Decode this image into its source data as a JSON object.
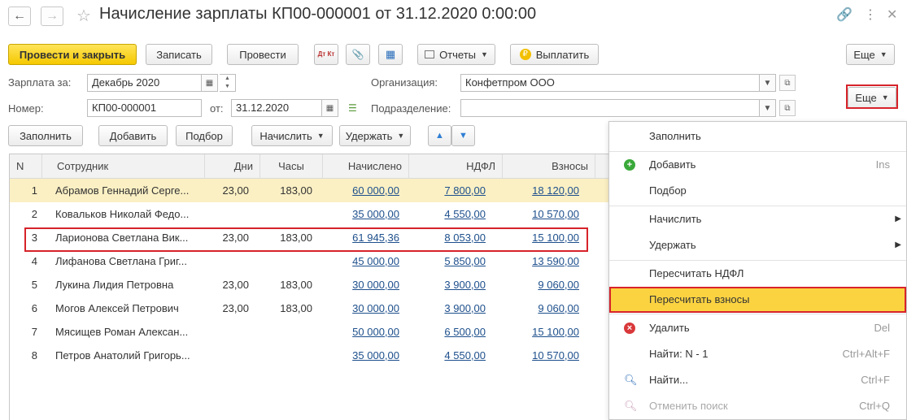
{
  "window": {
    "title": "Начисление зарплаты КП00-000001 от 31.12.2020 0:00:00",
    "back_icon": "←",
    "forward_icon": "→",
    "star_icon": "☆",
    "link_icon": "🔗",
    "more_icon": "⋮",
    "close_icon": "✕"
  },
  "toolbar": {
    "post_close": "Провести и закрыть",
    "save": "Записать",
    "post": "Провести",
    "dt_kt": "Дт Кт",
    "attach_icon": "📎",
    "structure_icon": "▦",
    "reports": "Отчеты",
    "pay": "Выплатить",
    "pay_icon": "₽",
    "more": "Еще"
  },
  "form": {
    "period_label": "Зарплата за:",
    "period_value": "Декабрь 2020",
    "org_label": "Организация:",
    "org_value": "Конфетпром ООО",
    "number_label": "Номер:",
    "number_value": "КП00-000001",
    "date_label": "от:",
    "date_value": "31.12.2020",
    "dept_label": "Подразделение:",
    "dept_value": ""
  },
  "table_toolbar": {
    "fill": "Заполнить",
    "add": "Добавить",
    "select": "Подбор",
    "accrue": "Начислить",
    "withhold": "Удержать",
    "more": "Еще",
    "up_icon": "▲",
    "down_icon": "▼"
  },
  "table": {
    "headers": [
      "N",
      "Сотрудник",
      "Дни",
      "Часы",
      "Начислено",
      "НДФЛ",
      "Взносы"
    ],
    "rows": [
      {
        "n": "1",
        "name": "Абрамов Геннадий Серге...",
        "days": "23,00",
        "hours": "183,00",
        "accrued": "60 000,00",
        "ndfl": "7 800,00",
        "contrib": "18 120,00"
      },
      {
        "n": "2",
        "name": "Ковальков Николай Федо...",
        "days": "",
        "hours": "",
        "accrued": "35 000,00",
        "ndfl": "4 550,00",
        "contrib": "10 570,00"
      },
      {
        "n": "3",
        "name": "Ларионова Светлана Вик...",
        "days": "23,00",
        "hours": "183,00",
        "accrued": "61 945,36",
        "ndfl": "8 053,00",
        "contrib": "15 100,00"
      },
      {
        "n": "4",
        "name": "Лифанова Светлана Григ...",
        "days": "",
        "hours": "",
        "accrued": "45 000,00",
        "ndfl": "5 850,00",
        "contrib": "13 590,00"
      },
      {
        "n": "5",
        "name": "Лукина Лидия Петровна",
        "days": "23,00",
        "hours": "183,00",
        "accrued": "30 000,00",
        "ndfl": "3 900,00",
        "contrib": "9 060,00"
      },
      {
        "n": "6",
        "name": "Могов Алексей Петрович",
        "days": "23,00",
        "hours": "183,00",
        "accrued": "30 000,00",
        "ndfl": "3 900,00",
        "contrib": "9 060,00"
      },
      {
        "n": "7",
        "name": "Мясищев Роман Алексан...",
        "days": "",
        "hours": "",
        "accrued": "50 000,00",
        "ndfl": "6 500,00",
        "contrib": "15 100,00"
      },
      {
        "n": "8",
        "name": "Петров Анатолий Григорь...",
        "days": "",
        "hours": "",
        "accrued": "35 000,00",
        "ndfl": "4 550,00",
        "contrib": "10 570,00"
      }
    ]
  },
  "menu": {
    "fill": "Заполнить",
    "add": "Добавить",
    "add_shortcut": "Ins",
    "select": "Подбор",
    "accrue": "Начислить",
    "withhold": "Удержать",
    "recalc_ndfl": "Пересчитать НДФЛ",
    "recalc_contrib": "Пересчитать взносы",
    "delete": "Удалить",
    "delete_shortcut": "Del",
    "find_n": "Найти: N - 1",
    "find_n_shortcut": "Ctrl+Alt+F",
    "find": "Найти...",
    "find_shortcut": "Ctrl+F",
    "cancel_search": "Отменить поиск",
    "cancel_search_shortcut": "Ctrl+Q"
  },
  "colors": {
    "primary_button": "#f5c800",
    "selected_row": "#fbf0c4",
    "menu_active": "#fbd341",
    "highlight_frame": "#d7232a",
    "link": "#1d4f8c"
  }
}
